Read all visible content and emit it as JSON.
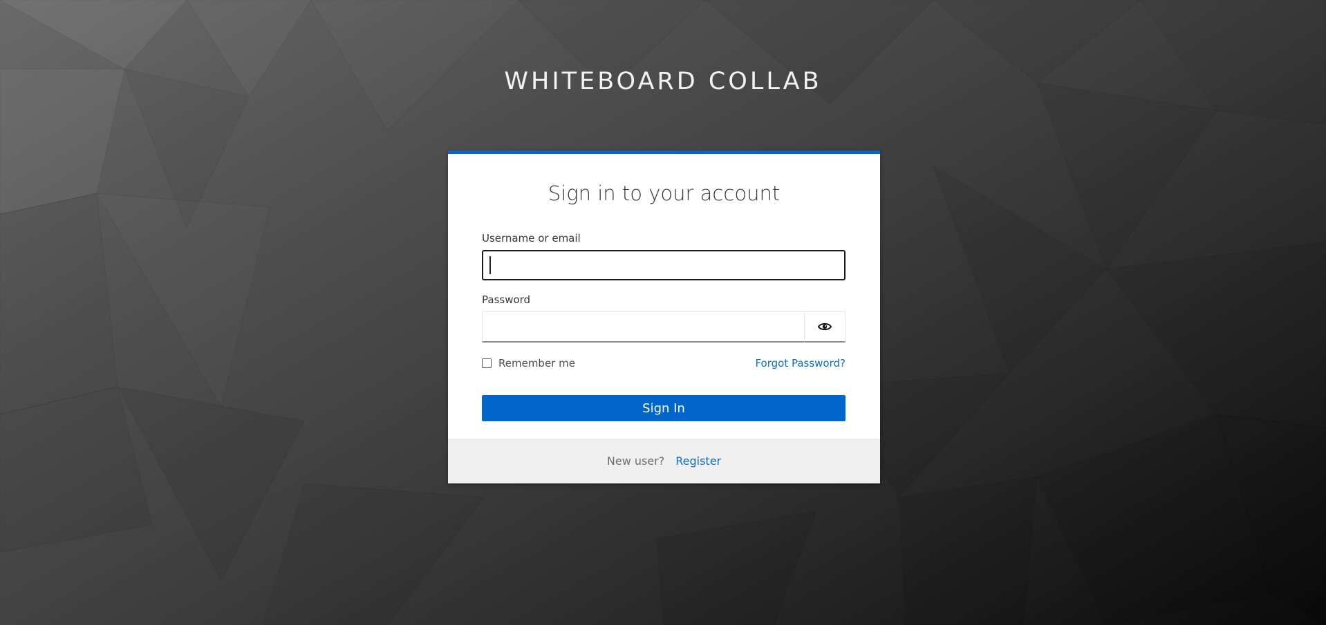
{
  "app": {
    "brand_title": "WHITEBOARD COLLAB"
  },
  "login": {
    "heading": "Sign in to your account",
    "username_label": "Username or email",
    "username_value": "",
    "password_label": "Password",
    "password_value": "",
    "show_password_icon": "eye-icon",
    "remember_me_label": "Remember me",
    "remember_me_checked": false,
    "forgot_password_link": "Forgot Password?",
    "sign_in_button": "Sign In"
  },
  "footer": {
    "new_user_text": "New user?",
    "register_link": "Register"
  },
  "colors": {
    "accent": "#0066cc",
    "link": "#0a6ebd",
    "card_top_border": "#0b66c3"
  }
}
